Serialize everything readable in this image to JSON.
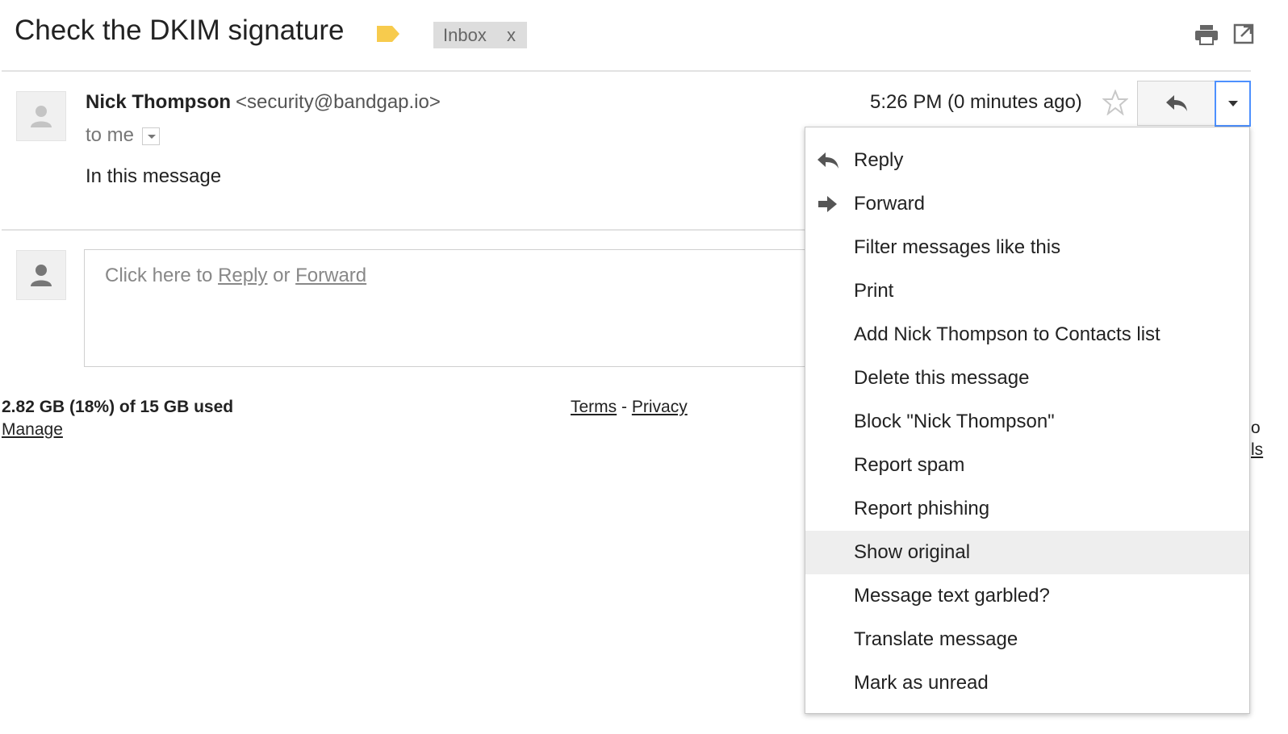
{
  "header": {
    "subject": "Check the DKIM signature",
    "label_chip": "Inbox",
    "label_chip_remove": "x",
    "label_tag_color": "#f7cb4d",
    "icons": [
      "label-tag-icon",
      "print-icon",
      "popout-icon"
    ]
  },
  "message": {
    "sender_name": "Nick Thompson",
    "sender_email": "<security@bandgap.io>",
    "recipient": "to me",
    "snippet": "In this message",
    "time": "5:26 PM (0 minutes ago)",
    "icons": [
      "avatar-icon",
      "star-icon",
      "reply-icon",
      "more-arrow-icon"
    ]
  },
  "reply_box": {
    "prefix": "Click here to",
    "reply_link": "Reply",
    "or": "or",
    "forward_link": "Forward"
  },
  "footer": {
    "storage": "2.82 GB (18%) of 15 GB used",
    "manage": "Manage",
    "terms": "Terms",
    "separator": "-",
    "privacy": "Privacy",
    "edge_line1": "o",
    "edge_line2": "ls"
  },
  "menu": {
    "items": [
      {
        "label": "Reply",
        "icon": "reply-icon"
      },
      {
        "label": "Forward",
        "icon": "forward-icon"
      },
      {
        "label": "Filter messages like this"
      },
      {
        "label": "Print"
      },
      {
        "label": "Add Nick Thompson to Contacts list"
      },
      {
        "label": "Delete this message"
      },
      {
        "label": "Block \"Nick Thompson\""
      },
      {
        "label": "Report spam"
      },
      {
        "label": "Report phishing"
      },
      {
        "label": "Show original",
        "highlighted": true
      },
      {
        "label": "Message text garbled?"
      },
      {
        "label": "Translate message"
      },
      {
        "label": "Mark as unread"
      }
    ]
  },
  "colors": {
    "accent_focus": "#4d90fe",
    "highlight": "#eeeeee"
  }
}
